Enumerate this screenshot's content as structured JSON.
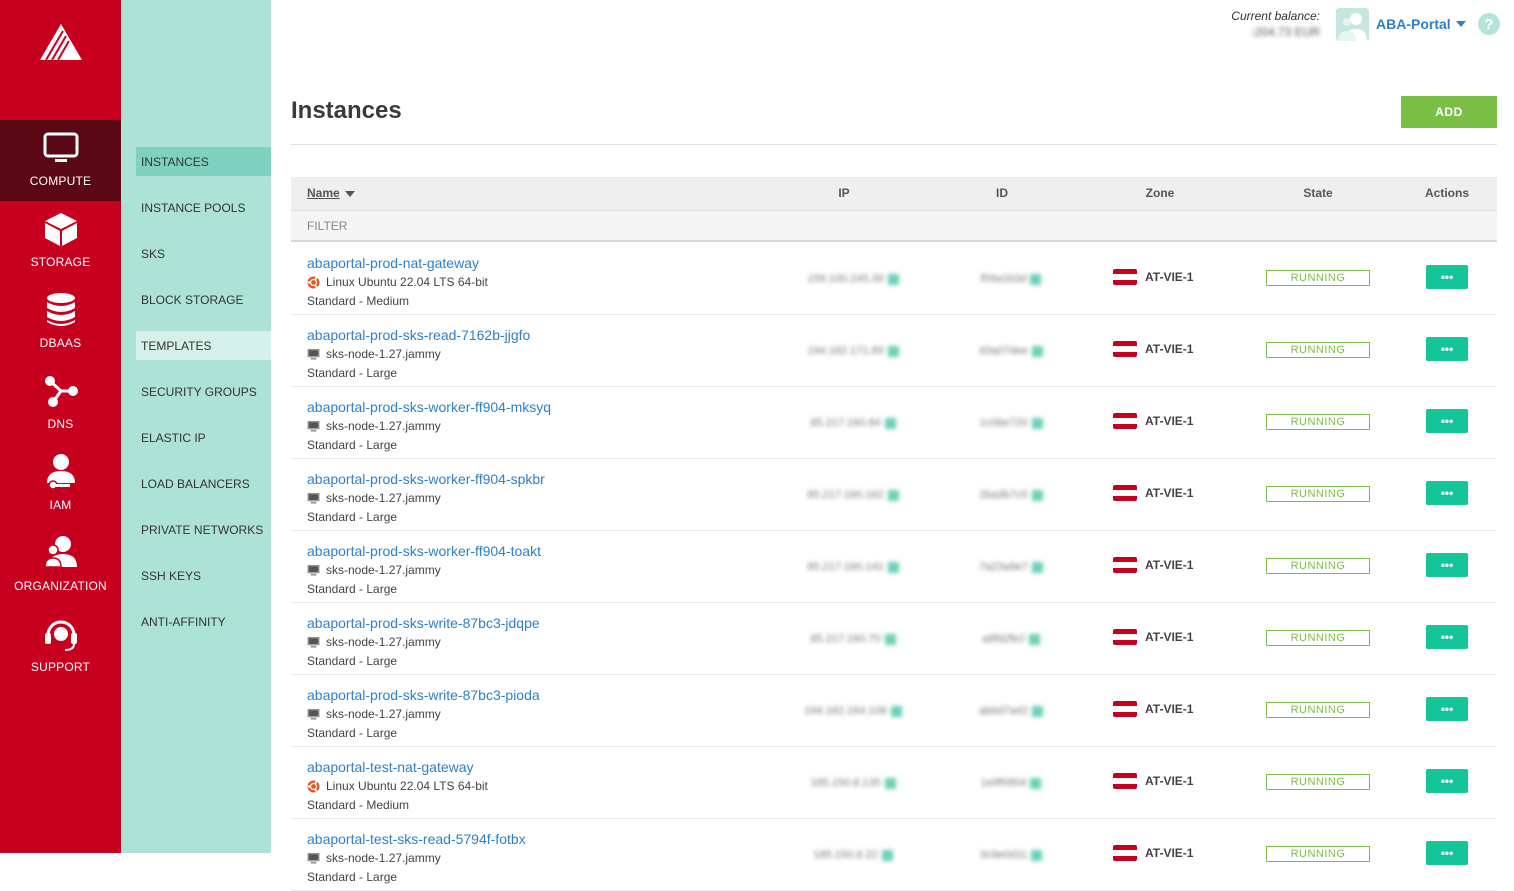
{
  "primary_nav": [
    {
      "label": "COMPUTE",
      "icon": "monitor-icon",
      "active": true
    },
    {
      "label": "STORAGE",
      "icon": "cube-icon"
    },
    {
      "label": "DBAAS",
      "icon": "database-icon"
    },
    {
      "label": "DNS",
      "icon": "network-nodes-icon"
    },
    {
      "label": "IAM",
      "icon": "user-key-icon"
    },
    {
      "label": "ORGANIZATION",
      "icon": "users-icon"
    },
    {
      "label": "SUPPORT",
      "icon": "headset-icon"
    }
  ],
  "secondary_nav": [
    {
      "label": "INSTANCES",
      "active": true
    },
    {
      "label": "INSTANCE POOLS"
    },
    {
      "label": "SKS"
    },
    {
      "label": "BLOCK STORAGE"
    },
    {
      "label": "TEMPLATES"
    },
    {
      "label": "SECURITY GROUPS"
    },
    {
      "label": "ELASTIC IP"
    },
    {
      "label": "LOAD BALANCERS"
    },
    {
      "label": "PRIVATE NETWORKS"
    },
    {
      "label": "SSH KEYS"
    },
    {
      "label": "ANTI-AFFINITY"
    }
  ],
  "topbar": {
    "balance_label": "Current balance:",
    "balance_value": "-204.73 EUR",
    "org_name": "ABA-Portal",
    "help_label": "?"
  },
  "page": {
    "title": "Instances",
    "add_label": "ADD"
  },
  "table": {
    "columns": {
      "name": "Name",
      "ip": "IP",
      "id": "ID",
      "zone": "Zone",
      "state": "State",
      "actions": "Actions"
    },
    "filter_placeholder": "FILTER",
    "action_label": "•••",
    "rows": [
      {
        "name": "abaportal-prod-nat-gateway",
        "os": "Linux Ubuntu 22.04 LTS 64-bit",
        "os_icon": "ubuntu-icon",
        "type": "Standard - Medium",
        "ip": "159.100.245.39",
        "id": "f59a1b3d",
        "zone": "AT-VIE-1",
        "state": "RUNNING"
      },
      {
        "name": "abaportal-prod-sks-read-7162b-jjgfo",
        "os": "sks-node-1.27.jammy",
        "os_icon": "template-icon",
        "type": "Standard - Large",
        "ip": "194.182.171.89",
        "id": "d3a07dee",
        "zone": "AT-VIE-1",
        "state": "RUNNING"
      },
      {
        "name": "abaportal-prod-sks-worker-ff904-mksyq",
        "os": "sks-node-1.27.jammy",
        "os_icon": "template-icon",
        "type": "Standard - Large",
        "ip": "85.217.160.84",
        "id": "1c0be720",
        "zone": "AT-VIE-1",
        "state": "RUNNING"
      },
      {
        "name": "abaportal-prod-sks-worker-ff904-spkbr",
        "os": "sks-node-1.27.jammy",
        "os_icon": "template-icon",
        "type": "Standard - Large",
        "ip": "85.217.160.162",
        "id": "2ba3b7c5",
        "zone": "AT-VIE-1",
        "state": "RUNNING"
      },
      {
        "name": "abaportal-prod-sks-worker-ff904-toakt",
        "os": "sks-node-1.27.jammy",
        "os_icon": "template-icon",
        "type": "Standard - Large",
        "ip": "85.217.160.141",
        "id": "7a23a9e7",
        "zone": "AT-VIE-1",
        "state": "RUNNING"
      },
      {
        "name": "abaportal-prod-sks-write-87bc3-jdqpe",
        "os": "sks-node-1.27.jammy",
        "os_icon": "template-icon",
        "type": "Standard - Large",
        "ip": "85.217.160.70",
        "id": "a8fd2fe2",
        "zone": "AT-VIE-1",
        "state": "RUNNING"
      },
      {
        "name": "abaportal-prod-sks-write-87bc3-pioda",
        "os": "sks-node-1.27.jammy",
        "os_icon": "template-icon",
        "type": "Standard - Large",
        "ip": "194.182.164.108",
        "id": "ab6d7a42",
        "zone": "AT-VIE-1",
        "state": "RUNNING"
      },
      {
        "name": "abaportal-test-nat-gateway",
        "os": "Linux Ubuntu 22.04 LTS 64-bit",
        "os_icon": "ubuntu-icon",
        "type": "Standard - Medium",
        "ip": "185.150.8.135",
        "id": "1e9f0904",
        "zone": "AT-VIE-1",
        "state": "RUNNING"
      },
      {
        "name": "abaportal-test-sks-read-5794f-fotbx",
        "os": "sks-node-1.27.jammy",
        "os_icon": "template-icon",
        "type": "Standard - Large",
        "ip": "185.150.8.22",
        "id": "3c9e0d11",
        "zone": "AT-VIE-1",
        "state": "RUNNING"
      }
    ]
  },
  "colors": {
    "primary_nav_bg": "#c8001f",
    "secondary_nav_bg": "#ade3d7",
    "link": "#2d7fc9",
    "running": "#7bbf47",
    "action_button": "#16c49a",
    "add_button": "#7bbf47"
  }
}
